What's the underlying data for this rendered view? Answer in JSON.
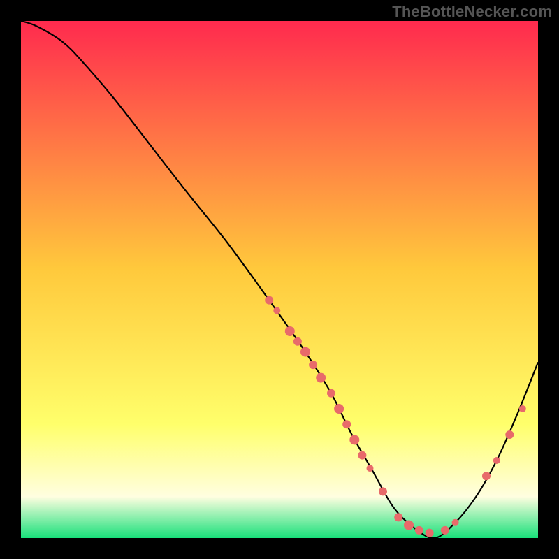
{
  "watermark": "TheBottleNecker.com",
  "chart_data": {
    "type": "line",
    "title": "",
    "xlabel": "",
    "ylabel": "",
    "xlim": [
      0,
      100
    ],
    "ylim": [
      0,
      100
    ],
    "background_gradient": {
      "top": "#ff2a4e",
      "mid1": "#ffc93c",
      "mid2": "#ffff6b",
      "band": "#fffee0",
      "bottom": "#18e07a"
    },
    "series": [
      {
        "name": "bottleneck-curve",
        "x": [
          0,
          3,
          8,
          12,
          18,
          25,
          32,
          40,
          48,
          55,
          60,
          64,
          68,
          72,
          76,
          80,
          84,
          88,
          92,
          96,
          100
        ],
        "y": [
          100,
          99,
          96,
          92,
          85,
          76,
          67,
          57,
          46,
          36,
          28,
          20,
          13,
          6,
          2,
          0,
          3,
          8,
          15,
          24,
          34
        ]
      }
    ],
    "markers": {
      "name": "highlight-points",
      "color": "#e86a6a",
      "points": [
        {
          "x": 48,
          "y": 46,
          "r": 6
        },
        {
          "x": 49.5,
          "y": 44,
          "r": 5
        },
        {
          "x": 52,
          "y": 40,
          "r": 7
        },
        {
          "x": 53.5,
          "y": 38,
          "r": 6
        },
        {
          "x": 55,
          "y": 36,
          "r": 7
        },
        {
          "x": 56.5,
          "y": 33.5,
          "r": 6
        },
        {
          "x": 58,
          "y": 31,
          "r": 7
        },
        {
          "x": 60,
          "y": 28,
          "r": 6
        },
        {
          "x": 61.5,
          "y": 25,
          "r": 7
        },
        {
          "x": 63,
          "y": 22,
          "r": 6
        },
        {
          "x": 64.5,
          "y": 19,
          "r": 7
        },
        {
          "x": 66,
          "y": 16,
          "r": 6
        },
        {
          "x": 67.5,
          "y": 13.5,
          "r": 5
        },
        {
          "x": 70,
          "y": 9,
          "r": 6
        },
        {
          "x": 73,
          "y": 4,
          "r": 6
        },
        {
          "x": 75,
          "y": 2.5,
          "r": 7
        },
        {
          "x": 77,
          "y": 1.5,
          "r": 6
        },
        {
          "x": 79,
          "y": 1,
          "r": 6
        },
        {
          "x": 82,
          "y": 1.5,
          "r": 6
        },
        {
          "x": 84,
          "y": 3,
          "r": 5
        },
        {
          "x": 90,
          "y": 12,
          "r": 6
        },
        {
          "x": 92,
          "y": 15,
          "r": 5
        },
        {
          "x": 94.5,
          "y": 20,
          "r": 6
        },
        {
          "x": 97,
          "y": 25,
          "r": 5
        }
      ]
    }
  }
}
